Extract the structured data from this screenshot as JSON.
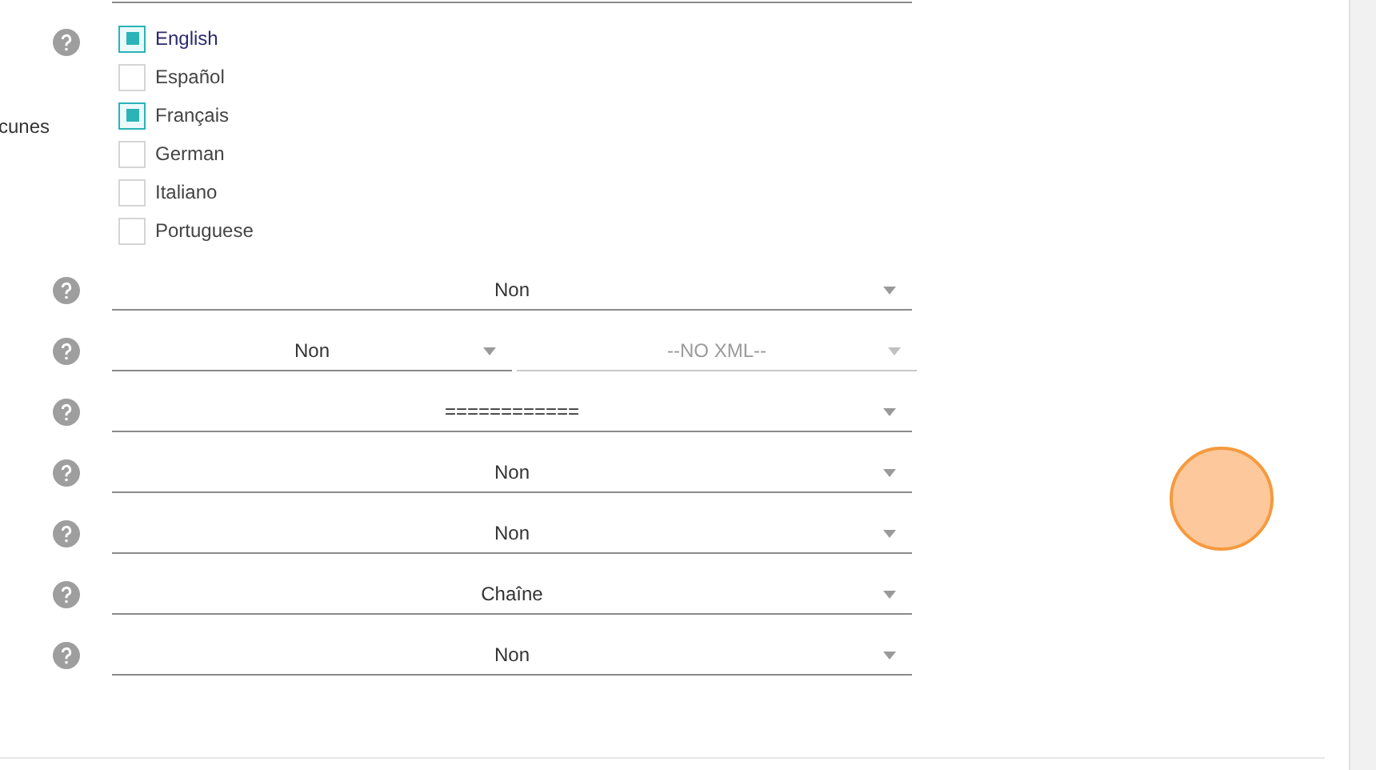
{
  "languages_field": {
    "label": "cunes",
    "options": [
      {
        "label": "English",
        "checked": true
      },
      {
        "label": "Español",
        "checked": false
      },
      {
        "label": "Français",
        "checked": true
      },
      {
        "label": "German",
        "checked": false
      },
      {
        "label": "Italiano",
        "checked": false
      },
      {
        "label": "Portuguese",
        "checked": false
      }
    ]
  },
  "select_rows": [
    {
      "kind": "single",
      "selects": [
        {
          "value": "Non",
          "disabled": false
        }
      ]
    },
    {
      "kind": "split",
      "selects": [
        {
          "value": "Non",
          "disabled": false
        },
        {
          "value": "--NO XML--",
          "disabled": true
        }
      ]
    },
    {
      "kind": "single",
      "selects": [
        {
          "value": "============",
          "disabled": false
        }
      ]
    },
    {
      "kind": "single",
      "selects": [
        {
          "value": "Non",
          "disabled": false
        }
      ]
    },
    {
      "kind": "single",
      "selects": [
        {
          "value": "Non",
          "disabled": false
        }
      ]
    },
    {
      "kind": "single",
      "selects": [
        {
          "value": "Chaîne",
          "disabled": false
        }
      ]
    },
    {
      "kind": "single",
      "selects": [
        {
          "value": "Non",
          "disabled": false
        }
      ]
    }
  ]
}
